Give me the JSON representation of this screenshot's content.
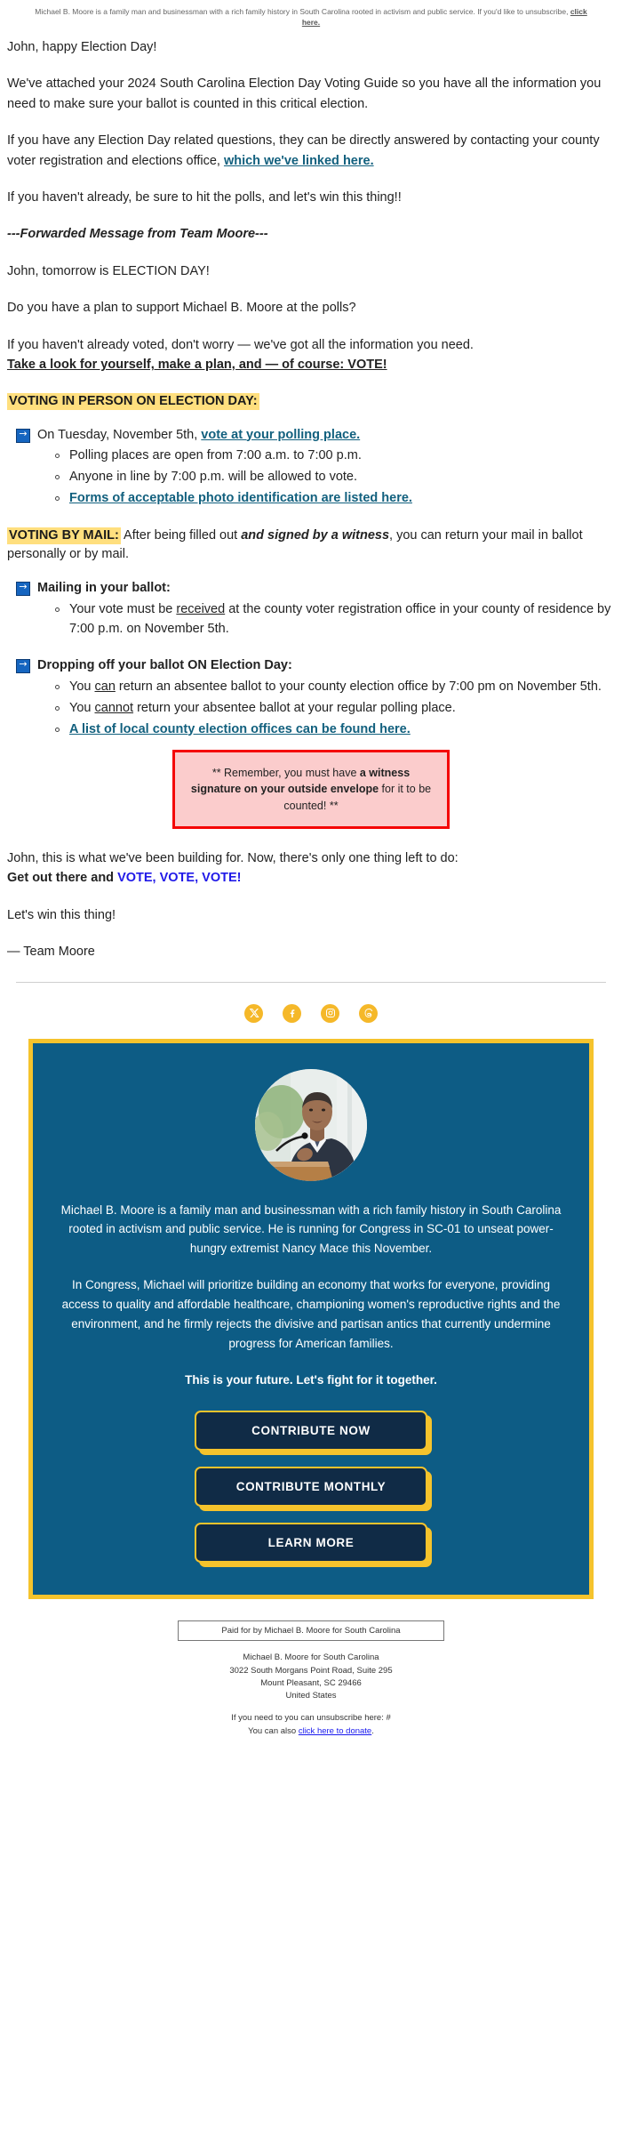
{
  "preheader": {
    "text": "Michael B. Moore is a family man and businessman with a rich family history in South Carolina rooted in activism and public service. If you'd like to unsubscribe, ",
    "link": "click here."
  },
  "intro": {
    "greeting": "John, happy Election Day!",
    "p1": "We've attached your 2024 South Carolina Election Day Voting Guide so you have all the information you need to make sure your ballot is counted in this critical election.",
    "p2_before": "If you have any Election Day related questions, they can be directly answered by contacting your county voter registration and elections office, ",
    "p2_link": "which we've linked here.",
    "p3": "If you haven't already, be sure to hit the polls, and let's win this thing!!",
    "forwarded": "---Forwarded Message from Team Moore---"
  },
  "forwarded_body": {
    "line1": "John, tomorrow is ELECTION DAY!",
    "line2": "Do you have a plan to support Michael B. Moore at the polls?",
    "line3": "If you haven't already voted, don't worry — we've got all the information you need.",
    "line3_bold": "Take a look for yourself, make a plan, and — of course: VOTE!"
  },
  "in_person": {
    "heading": "VOTING IN PERSON ON ELECTION DAY:",
    "arrow_text_before": "On Tuesday, November 5th, ",
    "arrow_link": "vote at your polling place.",
    "bullets": [
      {
        "text": "Polling places are open from 7:00 a.m. to 7:00 p.m.",
        "link": false
      },
      {
        "text": "Anyone in line by 7:00 p.m. will be allowed to vote.",
        "link": false
      },
      {
        "text": "Forms of acceptable photo identification are listed here.",
        "link": true
      }
    ]
  },
  "by_mail": {
    "heading": "VOTING BY MAIL:",
    "intro_a": " After being filled out ",
    "intro_b": "and signed by a witness",
    "intro_c": ", you can return your mail in ballot personally or by mail.",
    "group1": {
      "title": "Mailing in your ballot:",
      "bullets": [
        {
          "pre": "Your vote must be ",
          "u": "received",
          "post": " at the county voter registration office in your county of residence by 7:00 p.m. on November 5th."
        }
      ]
    },
    "group2": {
      "title": "Dropping off your ballot ON Election Day:",
      "bullets": [
        {
          "pre": "You ",
          "u": "can",
          "post": " return an absentee ballot to your county election office by 7:00 pm on November 5th."
        },
        {
          "pre": "You ",
          "u": "cannot",
          "post": " return your absentee ballot at your regular polling place."
        }
      ],
      "link_bullet": "A list of local county election offices can be found here."
    }
  },
  "warning": {
    "pre": "** Remember, you must have ",
    "bold": "a witness signature on your outside envelope",
    "post": " for it to be counted! **"
  },
  "closing": {
    "line1": "John, this is what we've been building for. Now, there's only one thing left to do:",
    "line2_bold": "Get out there and ",
    "line2_vote": "VOTE, VOTE, VOTE!",
    "line3": "Let's win this thing!",
    "signoff": "— Team Moore"
  },
  "social": [
    {
      "name": "x-twitter-icon",
      "label": "X"
    },
    {
      "name": "facebook-icon",
      "label": "Facebook"
    },
    {
      "name": "instagram-icon",
      "label": "Instagram"
    },
    {
      "name": "threads-icon",
      "label": "Threads"
    }
  ],
  "card": {
    "bio1": "Michael B. Moore is a family man and businessman with a rich family history in South Carolina rooted in activism and public service. He is running for Congress in SC-01 to unseat power-hungry extremist Nancy Mace this November.",
    "bio2": "In Congress, Michael will prioritize building an economy that works for everyone, providing access to quality and affordable healthcare, championing women's reproductive rights and the environment, and he firmly rejects the divisive and partisan antics that currently undermine progress for American families.",
    "tagline": "This is your future. Let's fight for it together.",
    "buttons": [
      "CONTRIBUTE NOW",
      "CONTRIBUTE MONTHLY",
      "LEARN MORE"
    ]
  },
  "footer": {
    "paid_for": "Paid for by Michael B. Moore for South Carolina",
    "org": "Michael B. Moore for South Carolina",
    "street": "3022 South Morgans Point Road, Suite 295",
    "city": "Mount Pleasant, SC 29466",
    "country": "United States",
    "unsub_line": "If you need to you can unsubscribe here: #",
    "donate_pre": "You can also ",
    "donate_link": "click here to donate",
    "donate_post": "."
  },
  "colors": {
    "highlight": "#ffdf7e",
    "link": "#12607e",
    "card_bg": "#0d5c85",
    "gold": "#f5c32c",
    "warn_border": "#f40505",
    "warn_bg": "#fbcccc",
    "vote_blue": "#2019e8"
  }
}
